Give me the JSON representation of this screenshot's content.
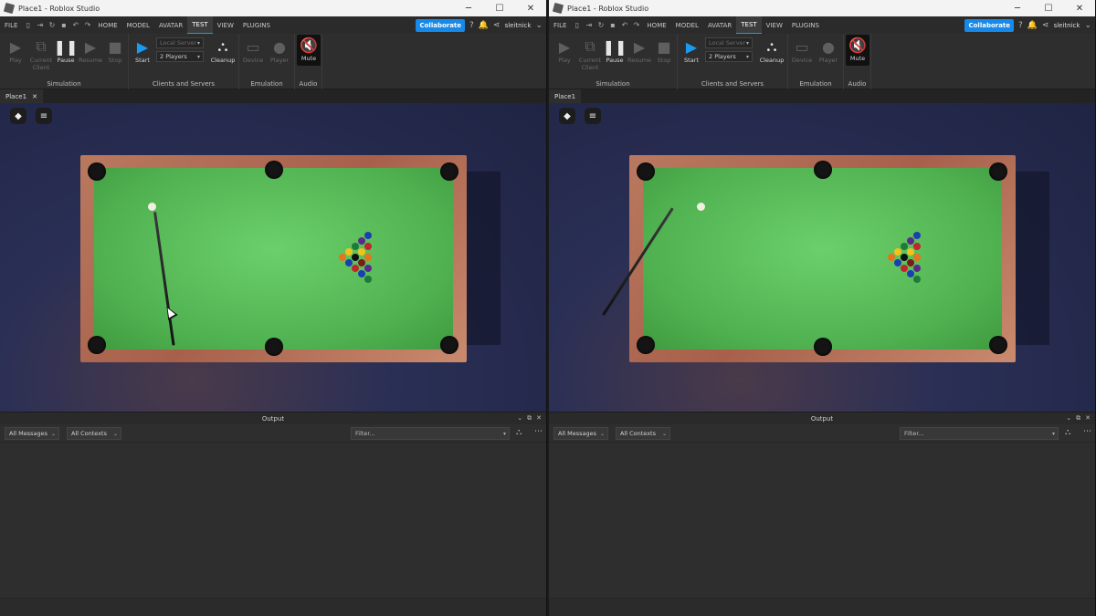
{
  "windows": [
    {
      "side": "left",
      "title": "Place1 - Roblox Studio",
      "menu": [
        "FILE",
        "HOME",
        "MODEL",
        "AVATAR",
        "TEST",
        "VIEW",
        "PLUGINS"
      ],
      "active_menu": "TEST",
      "collaborate_label": "Collaborate",
      "username": "sleitnick",
      "ribbon": {
        "play": "Play",
        "current_client": "Current Client",
        "pause": "Pause",
        "resume": "Resume",
        "stop": "Stop",
        "simulation_label": "Simulation",
        "start": "Start",
        "server_select": "Local Server",
        "players_select": "2 Players",
        "cleanup": "Cleanup",
        "clients_servers_label": "Clients and Servers",
        "device": "Device",
        "player": "Player",
        "emulation_label": "Emulation",
        "mute": "Mute",
        "audio_label": "Audio"
      },
      "doc_tab": "Place1",
      "output": {
        "title": "Output",
        "messages_filter": "All Messages",
        "contexts_filter": "All Contexts",
        "filter_placeholder": "Filter..."
      }
    },
    {
      "side": "right",
      "title": "Place1 - Roblox Studio",
      "menu": [
        "FILE",
        "HOME",
        "MODEL",
        "AVATAR",
        "TEST",
        "VIEW",
        "PLUGINS"
      ],
      "active_menu": "TEST",
      "collaborate_label": "Collaborate",
      "username": "sleitnick",
      "ribbon": {
        "play": "Play",
        "current_client": "Current Client",
        "pause": "Pause",
        "resume": "Resume",
        "stop": "Stop",
        "simulation_label": "Simulation",
        "start": "Start",
        "server_select": "Local Server",
        "players_select": "2 Players",
        "cleanup": "Cleanup",
        "clients_servers_label": "Clients and Servers",
        "device": "Device",
        "player": "Player",
        "emulation_label": "Emulation",
        "mute": "Mute",
        "audio_label": "Audio"
      },
      "doc_tab": "Place1",
      "output": {
        "title": "Output",
        "messages_filter": "All Messages",
        "contexts_filter": "All Contexts",
        "filter_placeholder": "Filter..."
      }
    }
  ],
  "colors": {
    "accent": "#1789e8",
    "felt": "#4fb04f",
    "rail": "#b06b52",
    "ball_colors": [
      "#f2c21a",
      "#1b3fb0",
      "#c0262b",
      "#5a2a8a",
      "#e8731c",
      "#1f7a3a",
      "#7a1a1a",
      "#111111"
    ]
  },
  "icons": [
    "minimize-icon",
    "maximize-icon",
    "close-icon",
    "new-file-icon",
    "open-icon",
    "undo-icon",
    "redo-icon",
    "bell-icon",
    "help-icon",
    "share-icon",
    "roblox-menu-icon",
    "chat-icon"
  ]
}
